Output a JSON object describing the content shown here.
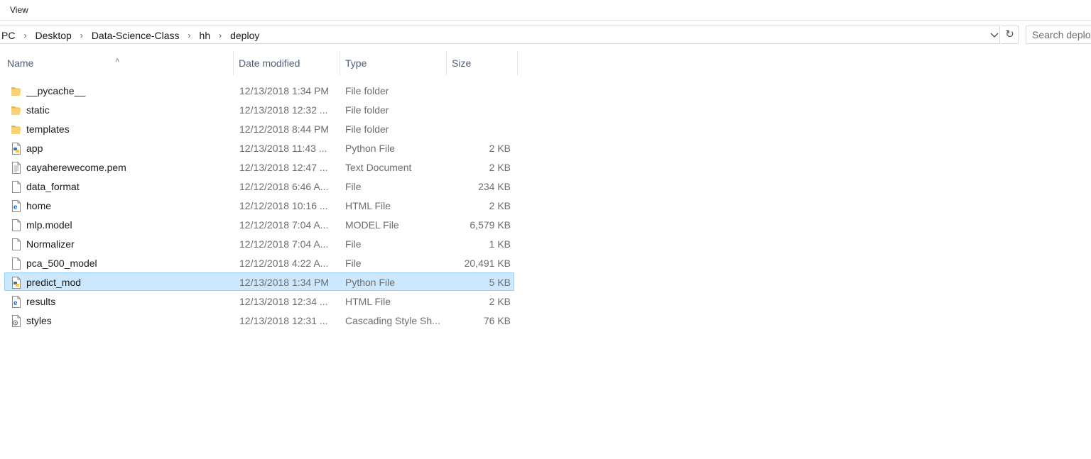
{
  "ribbon": {
    "view_tab": "View"
  },
  "breadcrumb": {
    "items": [
      "PC",
      "Desktop",
      "Data-Science-Class",
      "hh",
      "deploy"
    ]
  },
  "search": {
    "placeholder": "Search deploy"
  },
  "columns": {
    "name": "Name",
    "date": "Date modified",
    "type": "Type",
    "size": "Size"
  },
  "files": [
    {
      "name": "__pycache__",
      "date": "12/13/2018 1:34 PM",
      "type": "File folder",
      "size": "",
      "icon": "folder-icon",
      "selected": false
    },
    {
      "name": "static",
      "date": "12/13/2018 12:32 ...",
      "type": "File folder",
      "size": "",
      "icon": "folder-icon",
      "selected": false
    },
    {
      "name": "templates",
      "date": "12/12/2018 8:44 PM",
      "type": "File folder",
      "size": "",
      "icon": "folder-icon",
      "selected": false
    },
    {
      "name": "app",
      "date": "12/13/2018 11:43 ...",
      "type": "Python File",
      "size": "2 KB",
      "icon": "python-file-icon",
      "selected": false
    },
    {
      "name": "cayaherewecome.pem",
      "date": "12/13/2018 12:47 ...",
      "type": "Text Document",
      "size": "2 KB",
      "icon": "text-document-icon",
      "selected": false
    },
    {
      "name": "data_format",
      "date": "12/12/2018 6:46 A...",
      "type": "File",
      "size": "234 KB",
      "icon": "blank-file-icon",
      "selected": false
    },
    {
      "name": "home",
      "date": "12/12/2018 10:16 ...",
      "type": "HTML File",
      "size": "2 KB",
      "icon": "html-file-icon",
      "selected": false
    },
    {
      "name": "mlp.model",
      "date": "12/12/2018 7:04 A...",
      "type": "MODEL File",
      "size": "6,579 KB",
      "icon": "blank-file-icon",
      "selected": false
    },
    {
      "name": "Normalizer",
      "date": "12/12/2018 7:04 A...",
      "type": "File",
      "size": "1 KB",
      "icon": "blank-file-icon",
      "selected": false
    },
    {
      "name": "pca_500_model",
      "date": "12/12/2018 4:22 A...",
      "type": "File",
      "size": "20,491 KB",
      "icon": "blank-file-icon",
      "selected": false
    },
    {
      "name": "predict_mod",
      "date": "12/13/2018 1:34 PM",
      "type": "Python File",
      "size": "5 KB",
      "icon": "python-file-icon",
      "selected": true
    },
    {
      "name": "results",
      "date": "12/13/2018 12:34 ...",
      "type": "HTML File",
      "size": "2 KB",
      "icon": "html-file-icon",
      "selected": false
    },
    {
      "name": "styles",
      "date": "12/13/2018 12:31 ...",
      "type": "Cascading Style Sh...",
      "size": "76 KB",
      "icon": "css-file-icon",
      "selected": false
    }
  ]
}
